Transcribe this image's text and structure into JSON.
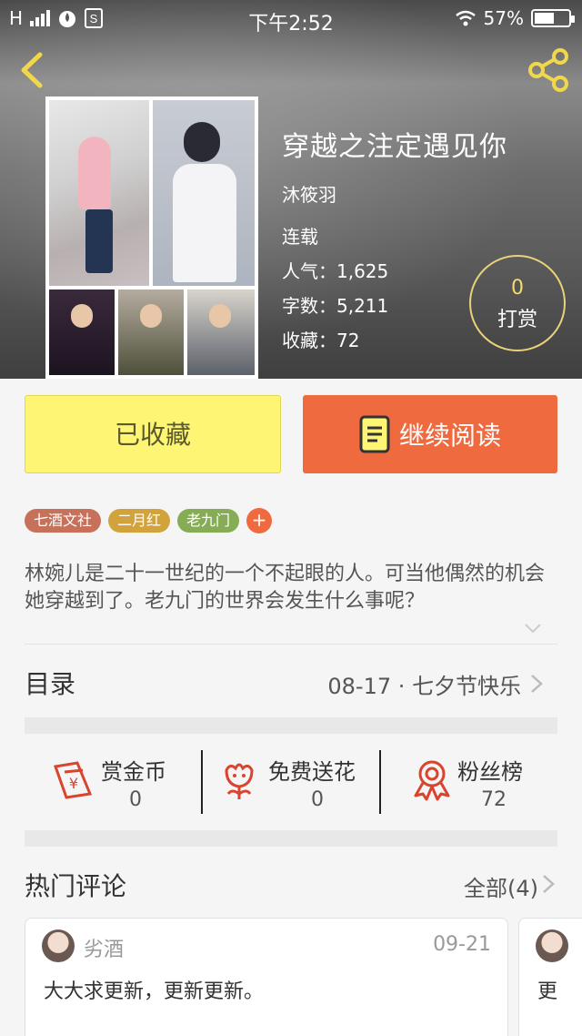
{
  "status_bar": {
    "carrier": "H",
    "time": "下午2:52",
    "battery": "57%",
    "battery_level": 0.57
  },
  "book": {
    "title": "穿越之注定遇见你",
    "author": "沐筱羽",
    "status": "连载",
    "popularity": "人气：1,625",
    "word_count": "字数：5,211",
    "favorites": "收藏：72"
  },
  "tip": {
    "count": "0",
    "label": "打赏"
  },
  "actions": {
    "collect_label": "已收藏",
    "read_label": "继续阅读"
  },
  "tags": [
    {
      "label": "七酒文社",
      "color": "#c7705a"
    },
    {
      "label": "二月红",
      "color": "#d2a33c"
    },
    {
      "label": "老九门",
      "color": "#86ad56"
    }
  ],
  "tag_add": "+",
  "description": "林婉儿是二十一世纪的一个不起眼的人。可当他偶然的机会她穿越到了。老九门的世界会发生什么事呢？",
  "toc": {
    "title": "目录",
    "latest": "08-17 · 七夕节快乐"
  },
  "stats": [
    {
      "label": "赏金币",
      "value": "0",
      "icon": "gold-coin-icon"
    },
    {
      "label": "免费送花",
      "value": "0",
      "icon": "flower-icon"
    },
    {
      "label": "粉丝榜",
      "value": "72",
      "icon": "ribbon-icon"
    }
  ],
  "comments_section": {
    "title": "热门评论",
    "all_label": "全部(4)"
  },
  "comments": [
    {
      "user": "劣酒",
      "date": "09-21",
      "text": "大大求更新，更新更新。"
    },
    {
      "user": "",
      "date": "",
      "text": "更"
    }
  ],
  "colors": {
    "accent_orange": "#ef6a3f",
    "collect_yellow": "#fff575",
    "icon_red": "#d9442e",
    "nav_yellow": "#f0d84a"
  }
}
